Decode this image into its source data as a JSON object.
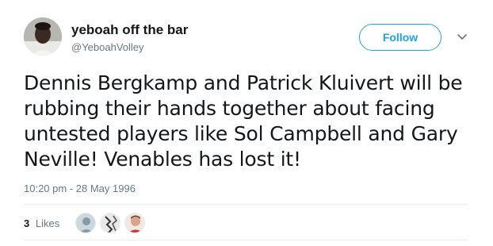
{
  "author": {
    "display_name": "yeboah off the bar",
    "handle": "@YeboahVolley"
  },
  "follow_button": {
    "label": "Follow"
  },
  "tweet": {
    "text": "Dennis Bergkamp and Patrick Kluivert will be rubbing their hands together about facing untested players like Sol Campbell and Gary Neville! Venables has lost it!",
    "timestamp": "10:20 pm - 28 May 1996"
  },
  "engagement": {
    "likes_count": "3",
    "likes_label": "Likes"
  },
  "icons": {
    "more": "chevron-down-icon"
  },
  "colors": {
    "accent": "#1da1f2",
    "secondary_text": "#657786",
    "divider": "#e6ecf0"
  }
}
